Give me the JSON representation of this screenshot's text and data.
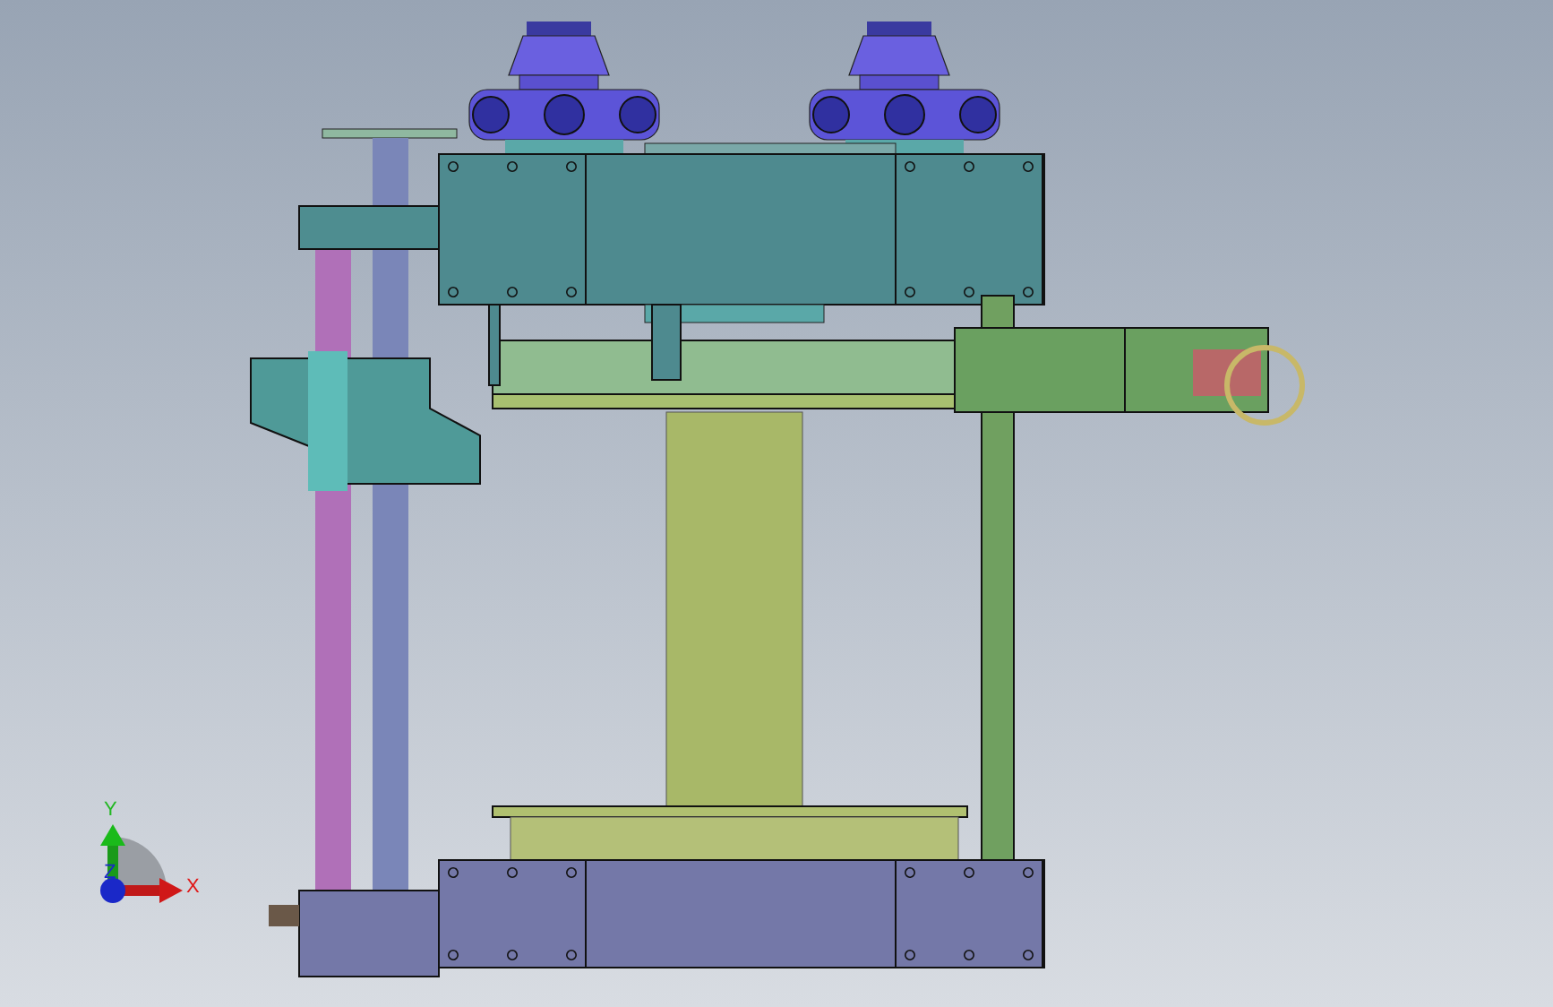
{
  "axis_triad": {
    "labels": [
      {
        "kind": "y",
        "text": "Y"
      },
      {
        "kind": "x",
        "text": "X"
      },
      {
        "kind": "z",
        "text": "Z"
      }
    ]
  }
}
